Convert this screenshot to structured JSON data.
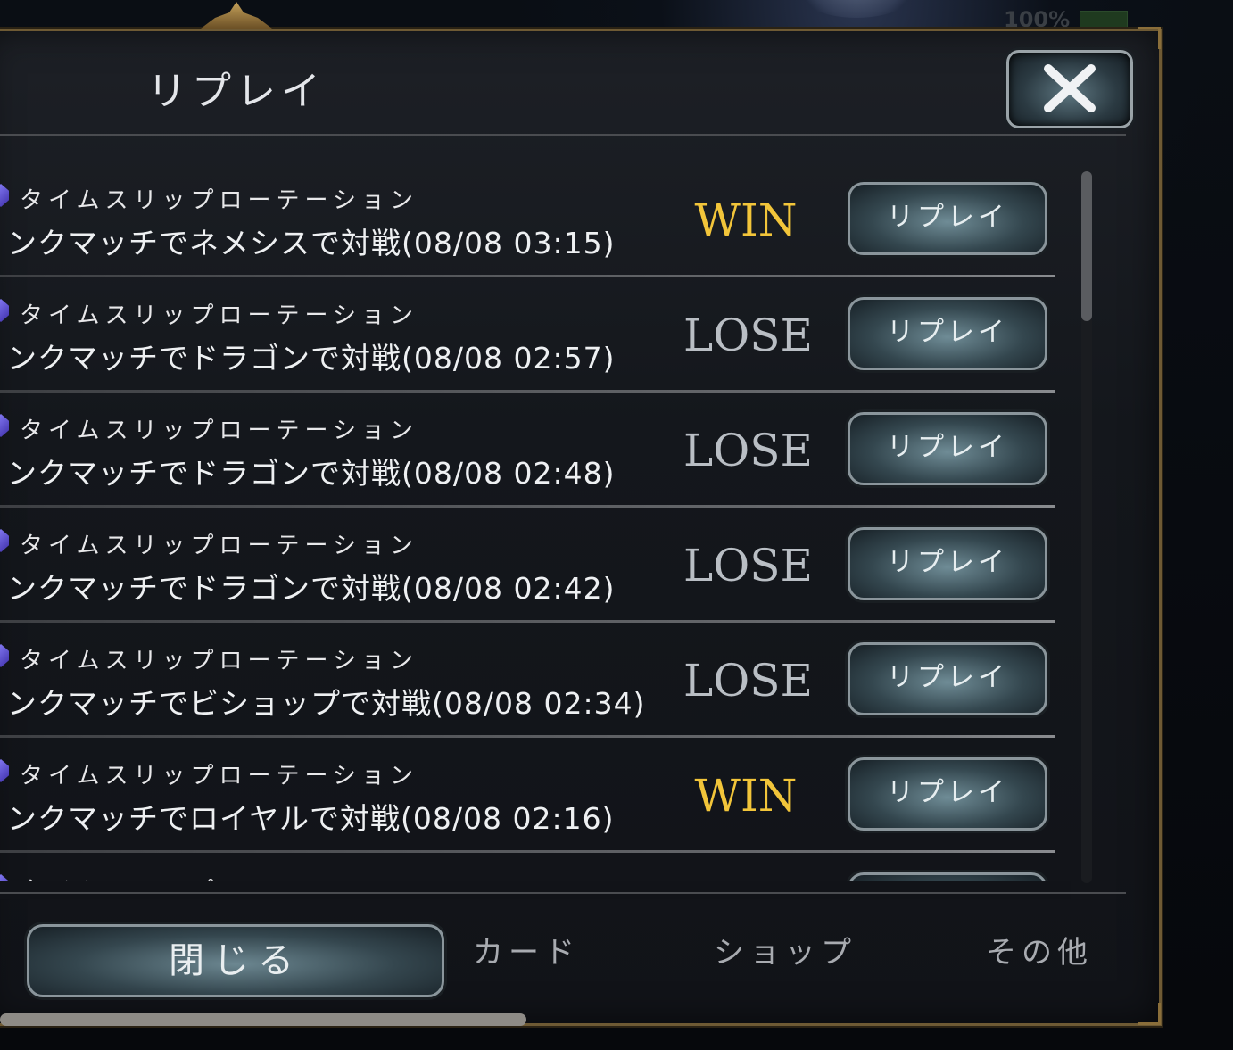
{
  "status": {
    "battery": "100%"
  },
  "dialog": {
    "title": "リプレイ",
    "close_icon": "close-x-icon",
    "replay_label": "リプレイ",
    "close_button": "閉じる"
  },
  "replays": [
    {
      "mode": "タイムスリップローテーション",
      "desc": "ンクマッチでネメシスで対戦(08/08 03:15)",
      "result": "WIN"
    },
    {
      "mode": "タイムスリップローテーション",
      "desc": "ンクマッチでドラゴンで対戦(08/08 02:57)",
      "result": "LOSE"
    },
    {
      "mode": "タイムスリップローテーション",
      "desc": "ンクマッチでドラゴンで対戦(08/08 02:48)",
      "result": "LOSE"
    },
    {
      "mode": "タイムスリップローテーション",
      "desc": "ンクマッチでドラゴンで対戦(08/08 02:42)",
      "result": "LOSE"
    },
    {
      "mode": "タイムスリップローテーション",
      "desc": "ンクマッチでビショップで対戦(08/08 02:34)",
      "result": "LOSE"
    },
    {
      "mode": "タイムスリップローテーション",
      "desc": "ンクマッチでロイヤルで対戦(08/08 02:16)",
      "result": "WIN"
    },
    {
      "mode": "タイムスリップローテーション",
      "desc": "",
      "result": ""
    }
  ],
  "background_tabs": [
    "カード",
    "ショップ",
    "その他"
  ],
  "colors": {
    "win": "#f2c53a",
    "lose": "#b9bec4",
    "border_gold": "#6e5a34"
  }
}
